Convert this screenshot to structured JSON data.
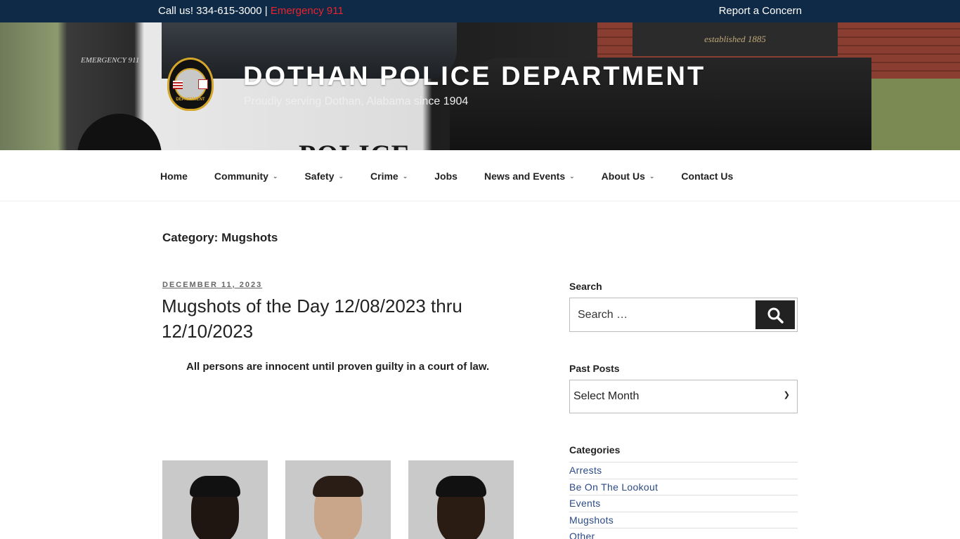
{
  "topbar": {
    "call_text": "Call us! 334-615-3000 |",
    "emergency_text": "Emergency 911",
    "report_link": "Report a Concern"
  },
  "header": {
    "title": "DOTHAN POLICE DEPARTMENT",
    "tagline": "Proudly serving Dothan, Alabama since 1904",
    "background_sign": "established 1885",
    "car_door_text": "POLICE",
    "car_emergency_text": "EMERGENCY 911",
    "badge_label": "DEPARTMENT"
  },
  "nav": {
    "items": [
      {
        "label": "Home",
        "has_dropdown": false
      },
      {
        "label": "Community",
        "has_dropdown": true
      },
      {
        "label": "Safety",
        "has_dropdown": true
      },
      {
        "label": "Crime",
        "has_dropdown": true
      },
      {
        "label": "Jobs",
        "has_dropdown": false
      },
      {
        "label": "News and Events",
        "has_dropdown": true
      },
      {
        "label": "About Us",
        "has_dropdown": true
      },
      {
        "label": "Contact Us",
        "has_dropdown": false
      }
    ]
  },
  "main": {
    "category_title": "Category: Mugshots",
    "post": {
      "date": "DECEMBER 11, 2023",
      "title": "Mugshots of the Day 12/08/2023 thru 12/10/2023",
      "disclaimer": "All persons are innocent until proven guilty in a court of law."
    }
  },
  "sidebar": {
    "search": {
      "title": "Search",
      "placeholder": "Search …"
    },
    "past_posts": {
      "title": "Past Posts",
      "selected": "Select Month"
    },
    "categories": {
      "title": "Categories",
      "items": [
        "Arrests",
        "Be On The Lookout",
        "Events",
        "Mugshots",
        "Other"
      ]
    }
  },
  "colors": {
    "topbar_bg": "#0f2a47",
    "emergency": "#e8242f",
    "link": "#2b4a87",
    "search_button": "#222222"
  }
}
